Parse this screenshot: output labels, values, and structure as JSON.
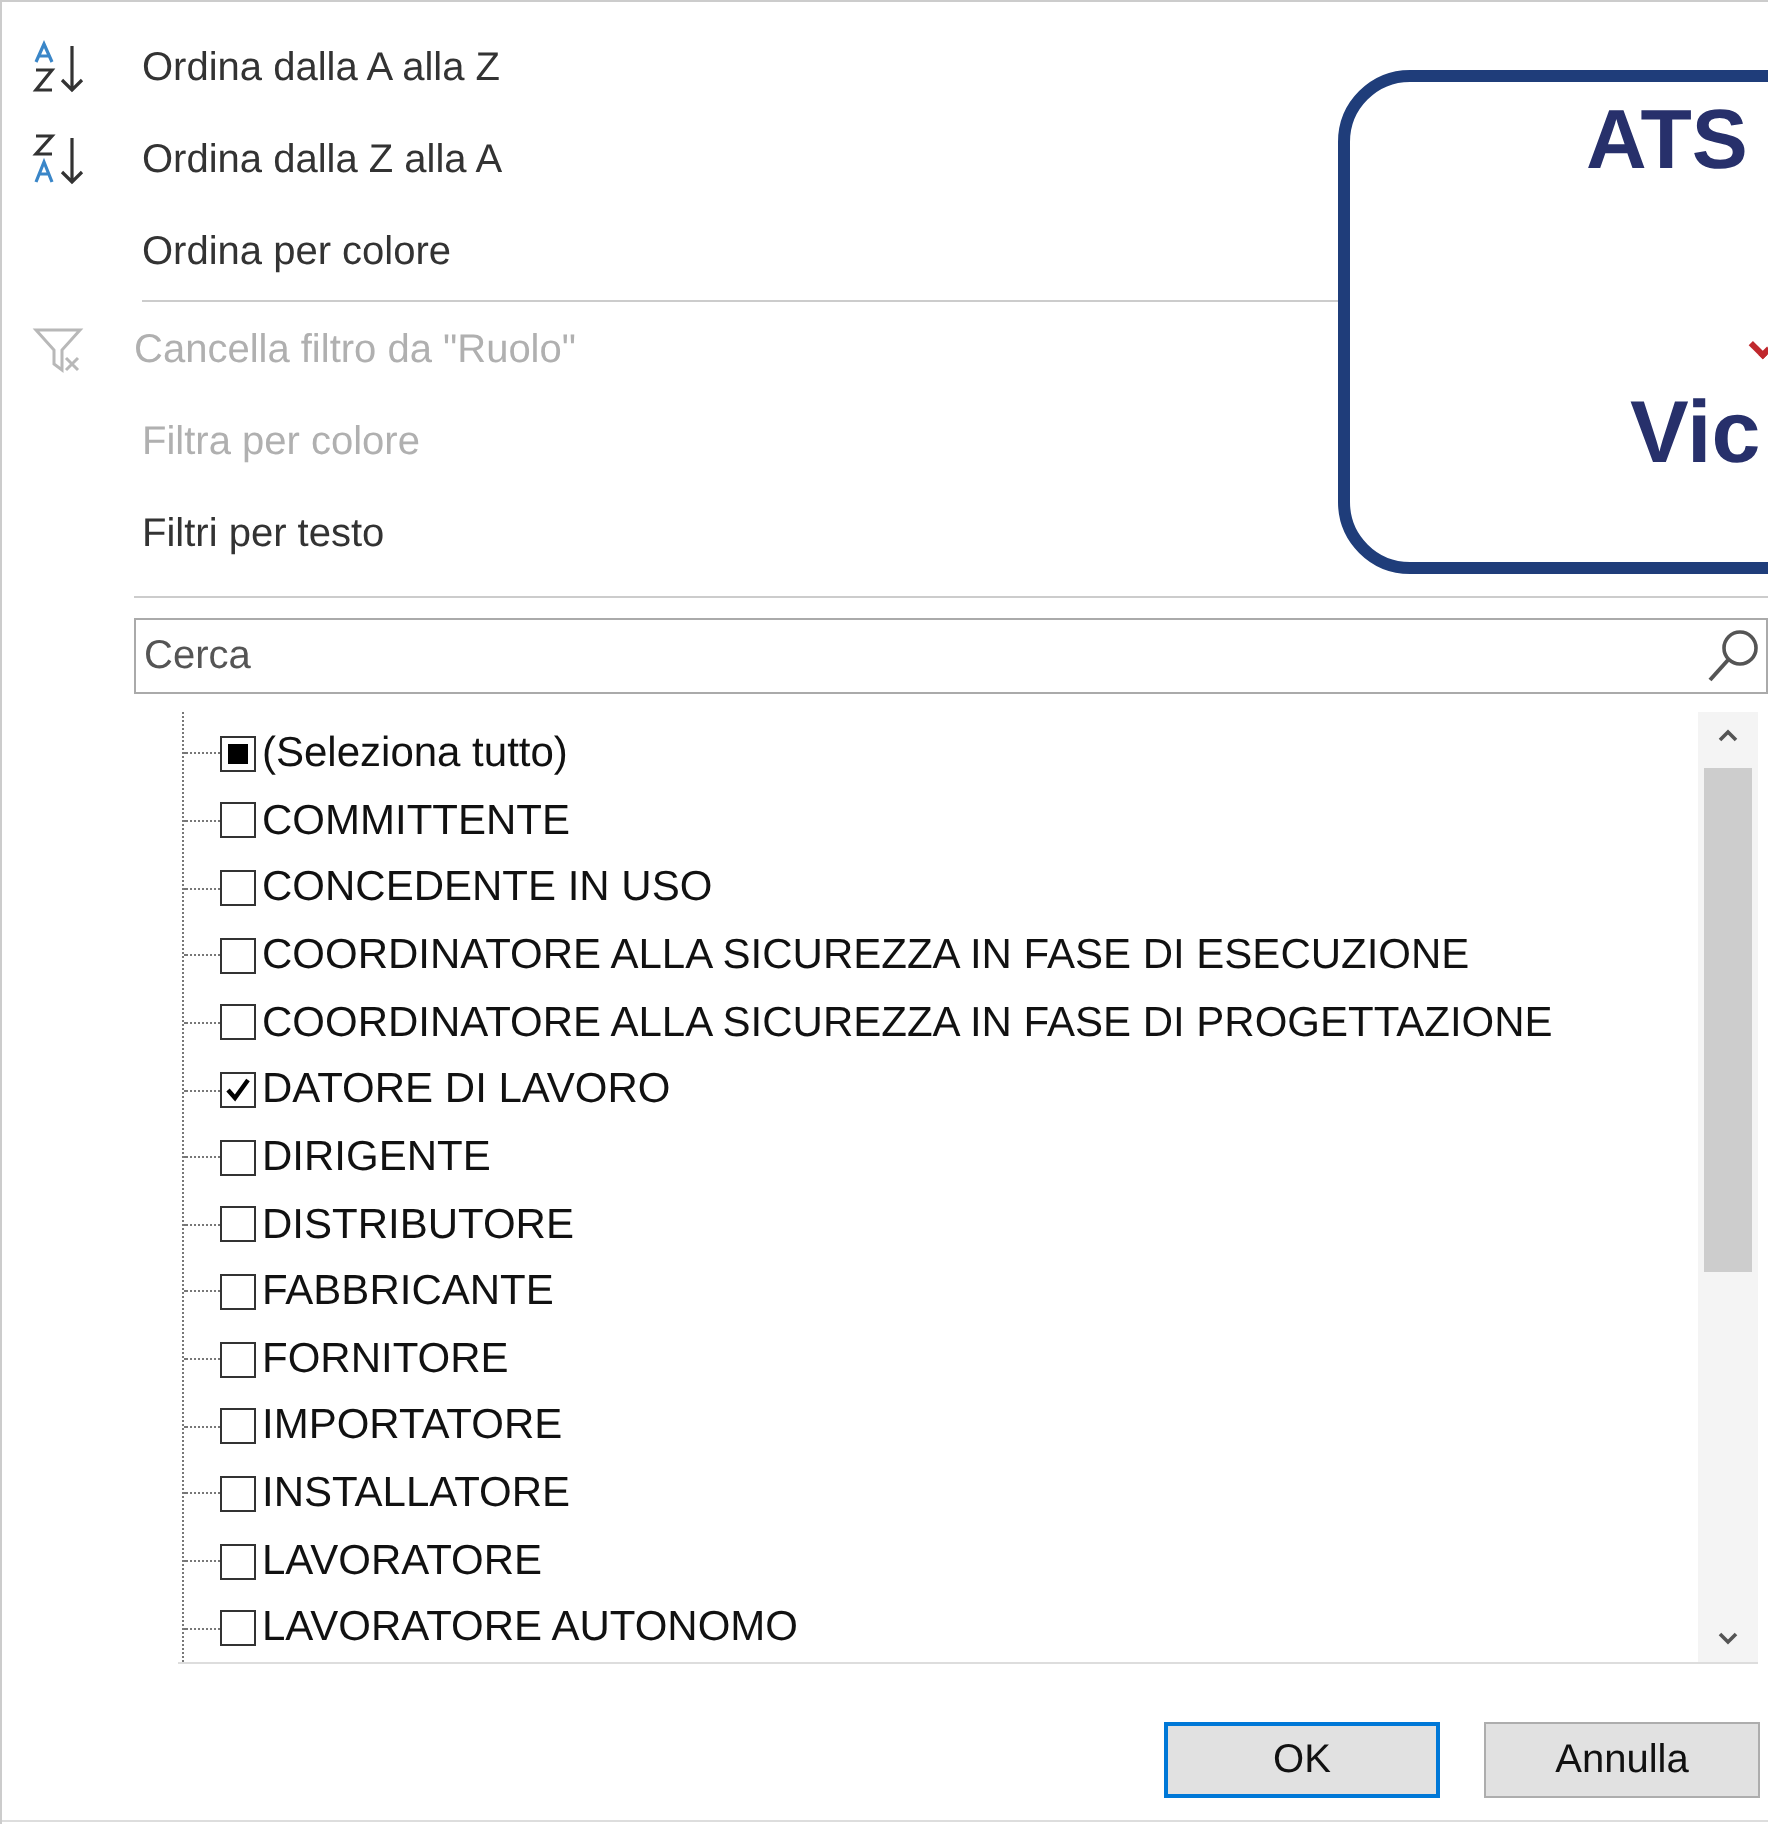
{
  "menu": [
    {
      "label": "Ordina dalla A alla Z",
      "kind": "sort-asc",
      "disabled": false
    },
    {
      "label": "Ordina dalla Z alla A",
      "kind": "sort-desc",
      "disabled": false
    },
    {
      "label": "Ordina per colore",
      "kind": "plain",
      "disabled": false
    },
    {
      "kind": "separator"
    },
    {
      "label": "Cancella filtro da \"Ruolo\"",
      "kind": "clear-filter",
      "disabled": true
    },
    {
      "label": "Filtra per colore",
      "kind": "plain",
      "disabled": true
    },
    {
      "label": "Filtri per testo",
      "kind": "plain",
      "disabled": false
    }
  ],
  "search": {
    "placeholder": "Cerca"
  },
  "select_all": {
    "label": "(Seleziona tutto)",
    "indeterminate": true
  },
  "list": [
    {
      "label": "COMMITTENTE",
      "checked": false
    },
    {
      "label": "CONCEDENTE IN USO",
      "checked": false
    },
    {
      "label": "COORDINATORE ALLA SICUREZZA IN FASE DI ESECUZIONE",
      "checked": false
    },
    {
      "label": "COORDINATORE ALLA SICUREZZA IN FASE DI PROGETTAZIONE",
      "checked": false
    },
    {
      "label": "DATORE DI LAVORO",
      "checked": true
    },
    {
      "label": "DIRIGENTE",
      "checked": false
    },
    {
      "label": "DISTRIBUTORE",
      "checked": false
    },
    {
      "label": "FABBRICANTE",
      "checked": false
    },
    {
      "label": "FORNITORE",
      "checked": false
    },
    {
      "label": "IMPORTATORE",
      "checked": false
    },
    {
      "label": "INSTALLATORE",
      "checked": false
    },
    {
      "label": "LAVORATORE",
      "checked": false
    },
    {
      "label": "LAVORATORE AUTONOMO",
      "checked": false
    }
  ],
  "buttons": [
    {
      "label": "OK",
      "selected": true
    },
    {
      "label": "Annulla",
      "selected": false
    }
  ],
  "overlay": {
    "title": "ATS",
    "subtitle": "Vic"
  }
}
